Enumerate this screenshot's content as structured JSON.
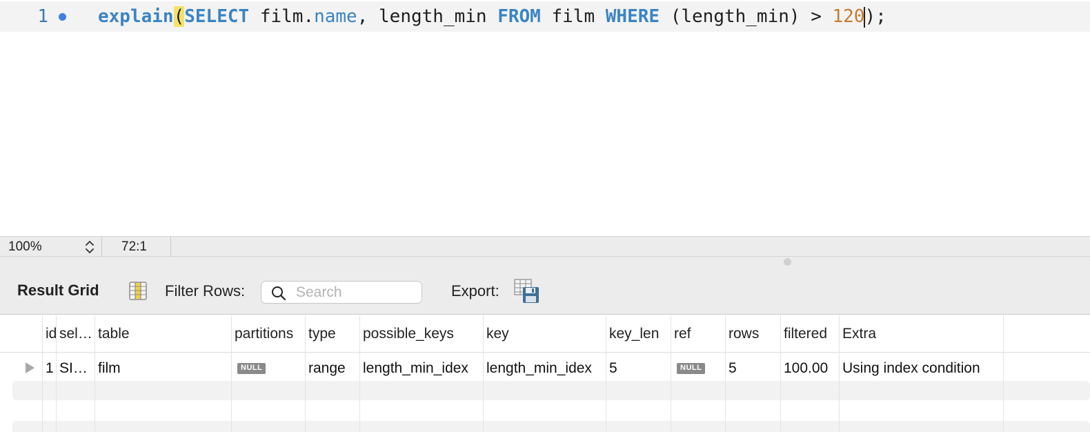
{
  "editor": {
    "line_number": "1",
    "tokens": {
      "t1": "explain",
      "t2": "(",
      "t3": "S",
      "t4": "ELECT",
      "t5": " film.",
      "t6": "name",
      "t7": ", length_min ",
      "t8": "FROM",
      "t9": " film ",
      "t10": "WHERE",
      "t11": " (length_min) > ",
      "t12": "120",
      "t13": ");"
    }
  },
  "statusbar": {
    "zoom": "100%",
    "cursor_position": "72:1"
  },
  "toolbar": {
    "title": "Result Grid",
    "filter_label": "Filter Rows:",
    "search_placeholder": "Search",
    "export_label": "Export:"
  },
  "grid": {
    "columns": [
      "id",
      "sel…",
      "table",
      "partitions",
      "type",
      "possible_keys",
      "key",
      "key_len",
      "ref",
      "rows",
      "filtered",
      "Extra"
    ],
    "rows": [
      {
        "id": "1",
        "select_type": "SI…",
        "table": "film",
        "partitions": "NULL",
        "type": "range",
        "possible_keys": "length_min_idex",
        "key": "length_min_idex",
        "key_len": "5",
        "ref": "NULL",
        "rows": "5",
        "filtered": "100.00",
        "extra": "Using index condition"
      }
    ]
  },
  "colors": {
    "keyword": "#3a84c3",
    "number": "#c97a2e",
    "highlight": "#f3e26a",
    "breakpoint": "#3b82e0"
  }
}
